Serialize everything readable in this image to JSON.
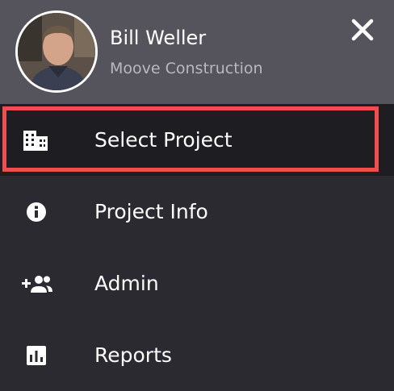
{
  "user": {
    "name": "Bill Weller",
    "company": "Moove Construction"
  },
  "header": {
    "close_icon": "close-icon"
  },
  "menu": {
    "items": [
      {
        "label": "Select Project",
        "icon": "building-icon",
        "selected": true
      },
      {
        "label": "Project Info",
        "icon": "info-icon",
        "selected": false
      },
      {
        "label": "Admin",
        "icon": "group-add-icon",
        "selected": false
      },
      {
        "label": "Reports",
        "icon": "bar-chart-icon",
        "selected": false
      }
    ]
  },
  "colors": {
    "header_bg": "#55545d",
    "menu_bg": "#2b2a30",
    "selected_bg": "#1e1d22",
    "highlight": "#f04e4e",
    "secondary_text": "#b9b8be"
  }
}
